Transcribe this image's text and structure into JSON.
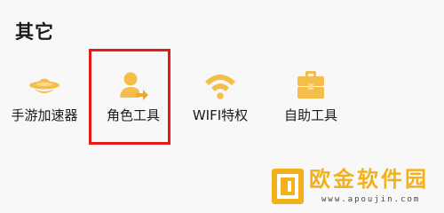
{
  "section": {
    "title": "其它"
  },
  "tools": [
    {
      "label": "手游加速器",
      "icon": "speedboat-icon"
    },
    {
      "label": "角色工具",
      "icon": "character-share-icon"
    },
    {
      "label": "WIFI特权",
      "icon": "wifi-icon"
    },
    {
      "label": "自助工具",
      "icon": "toolbox-icon"
    }
  ],
  "highlight": {
    "target": "角色工具",
    "color": "#e51a1a"
  },
  "watermark": {
    "brand": "欧金软件园",
    "url": "www.apoujin.com"
  },
  "colors": {
    "icon_accent": "#f5be4a",
    "background": "#f8f8f8",
    "text": "#1a1a1a"
  }
}
